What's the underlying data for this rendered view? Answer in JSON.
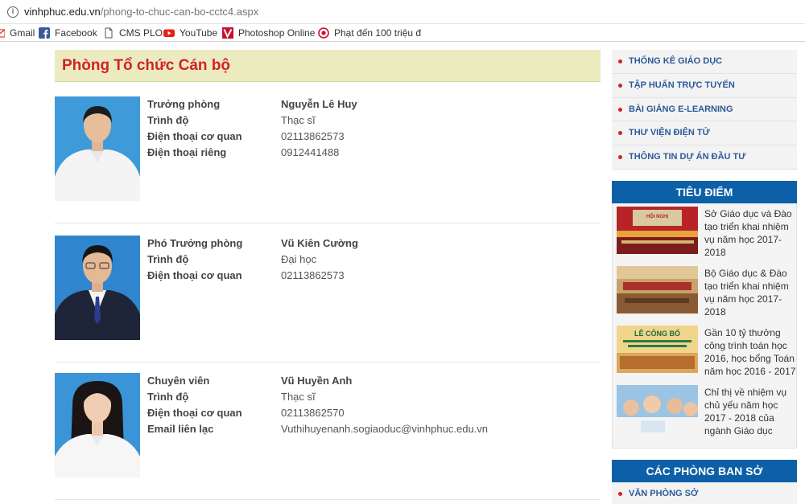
{
  "browser": {
    "url_host": "vinhphuc.edu.vn",
    "url_path": "/phong-to-chuc-can-bo-cctc4.aspx",
    "bookmarks": [
      {
        "label": "Gmail",
        "icon": "gmail-icon"
      },
      {
        "label": "Facebook",
        "icon": "facebook-icon"
      },
      {
        "label": "CMS PLO",
        "icon": "page-icon"
      },
      {
        "label": "YouTube",
        "icon": "youtube-icon"
      },
      {
        "label": "Photoshop Online",
        "icon": "photoshop-icon"
      },
      {
        "label": "Phạt đến 100 triệu đ",
        "icon": "news-icon"
      }
    ]
  },
  "main": {
    "title": "Phòng Tổ chức Cán bộ",
    "people": [
      {
        "rows": [
          {
            "label": "Trưởng phòng",
            "value": "Nguyễn Lê Huy"
          },
          {
            "label": "Trình độ",
            "value": "Thạc sĩ"
          },
          {
            "label": "Điện thoại cơ quan",
            "value": "02113862573"
          },
          {
            "label": "Điện thoại riêng",
            "value": "0912441488"
          }
        ]
      },
      {
        "rows": [
          {
            "label": "Phó Trưởng phòng",
            "value": "Vũ Kiên Cường"
          },
          {
            "label": "Trình độ",
            "value": "Đại học"
          },
          {
            "label": "Điện thoại cơ quan",
            "value": "02113862573"
          }
        ]
      },
      {
        "rows": [
          {
            "label": "Chuyên viên",
            "value": "Vũ Huyền Anh"
          },
          {
            "label": "Trình độ",
            "value": "Thạc sĩ"
          },
          {
            "label": "Điện thoại cơ quan",
            "value": "02113862570"
          },
          {
            "label": "Email liên lạc",
            "value": "Vuthihuyenanh.sogiaoduc@vinhphuc.edu.vn"
          }
        ]
      }
    ]
  },
  "sidebar": {
    "menu": [
      "THỐNG KÊ GIÁO DỤC",
      "TẬP HUẤN TRỰC TUYẾN",
      "BÀI GIẢNG E-LEARNING",
      "THƯ VIỆN ĐIỆN TỬ",
      "THÔNG TIN DỰ ÁN ĐẦU TƯ"
    ],
    "featured_title": "TIÊU ĐIỂM",
    "featured": [
      "Sở Giáo dục và Đào tạo triển khai nhiệm vụ năm học 2017-2018",
      "Bộ Giáo dục & Đào tạo triển khai nhiệm vụ năm học 2017-2018",
      "Gần 10 tỷ thưởng công trình toán học 2016, học bổng Toán năm học 2016 - 2017",
      "Chỉ thị về nhiệm vụ chủ yếu năm học 2017 - 2018 của ngành Giáo dục"
    ],
    "thumb_texts": {
      "hoi_nghi": "HỘI NGHỊ",
      "le_cong_bo": "LỄ CÔNG BỐ"
    },
    "departments_title": "CÁC PHÒNG BAN SỞ",
    "departments": [
      "VĂN PHÒNG SỞ"
    ],
    "colors": {
      "accent_blue": "#0c60a8",
      "title_red": "#d32127",
      "title_bg": "#ecebbf"
    }
  }
}
